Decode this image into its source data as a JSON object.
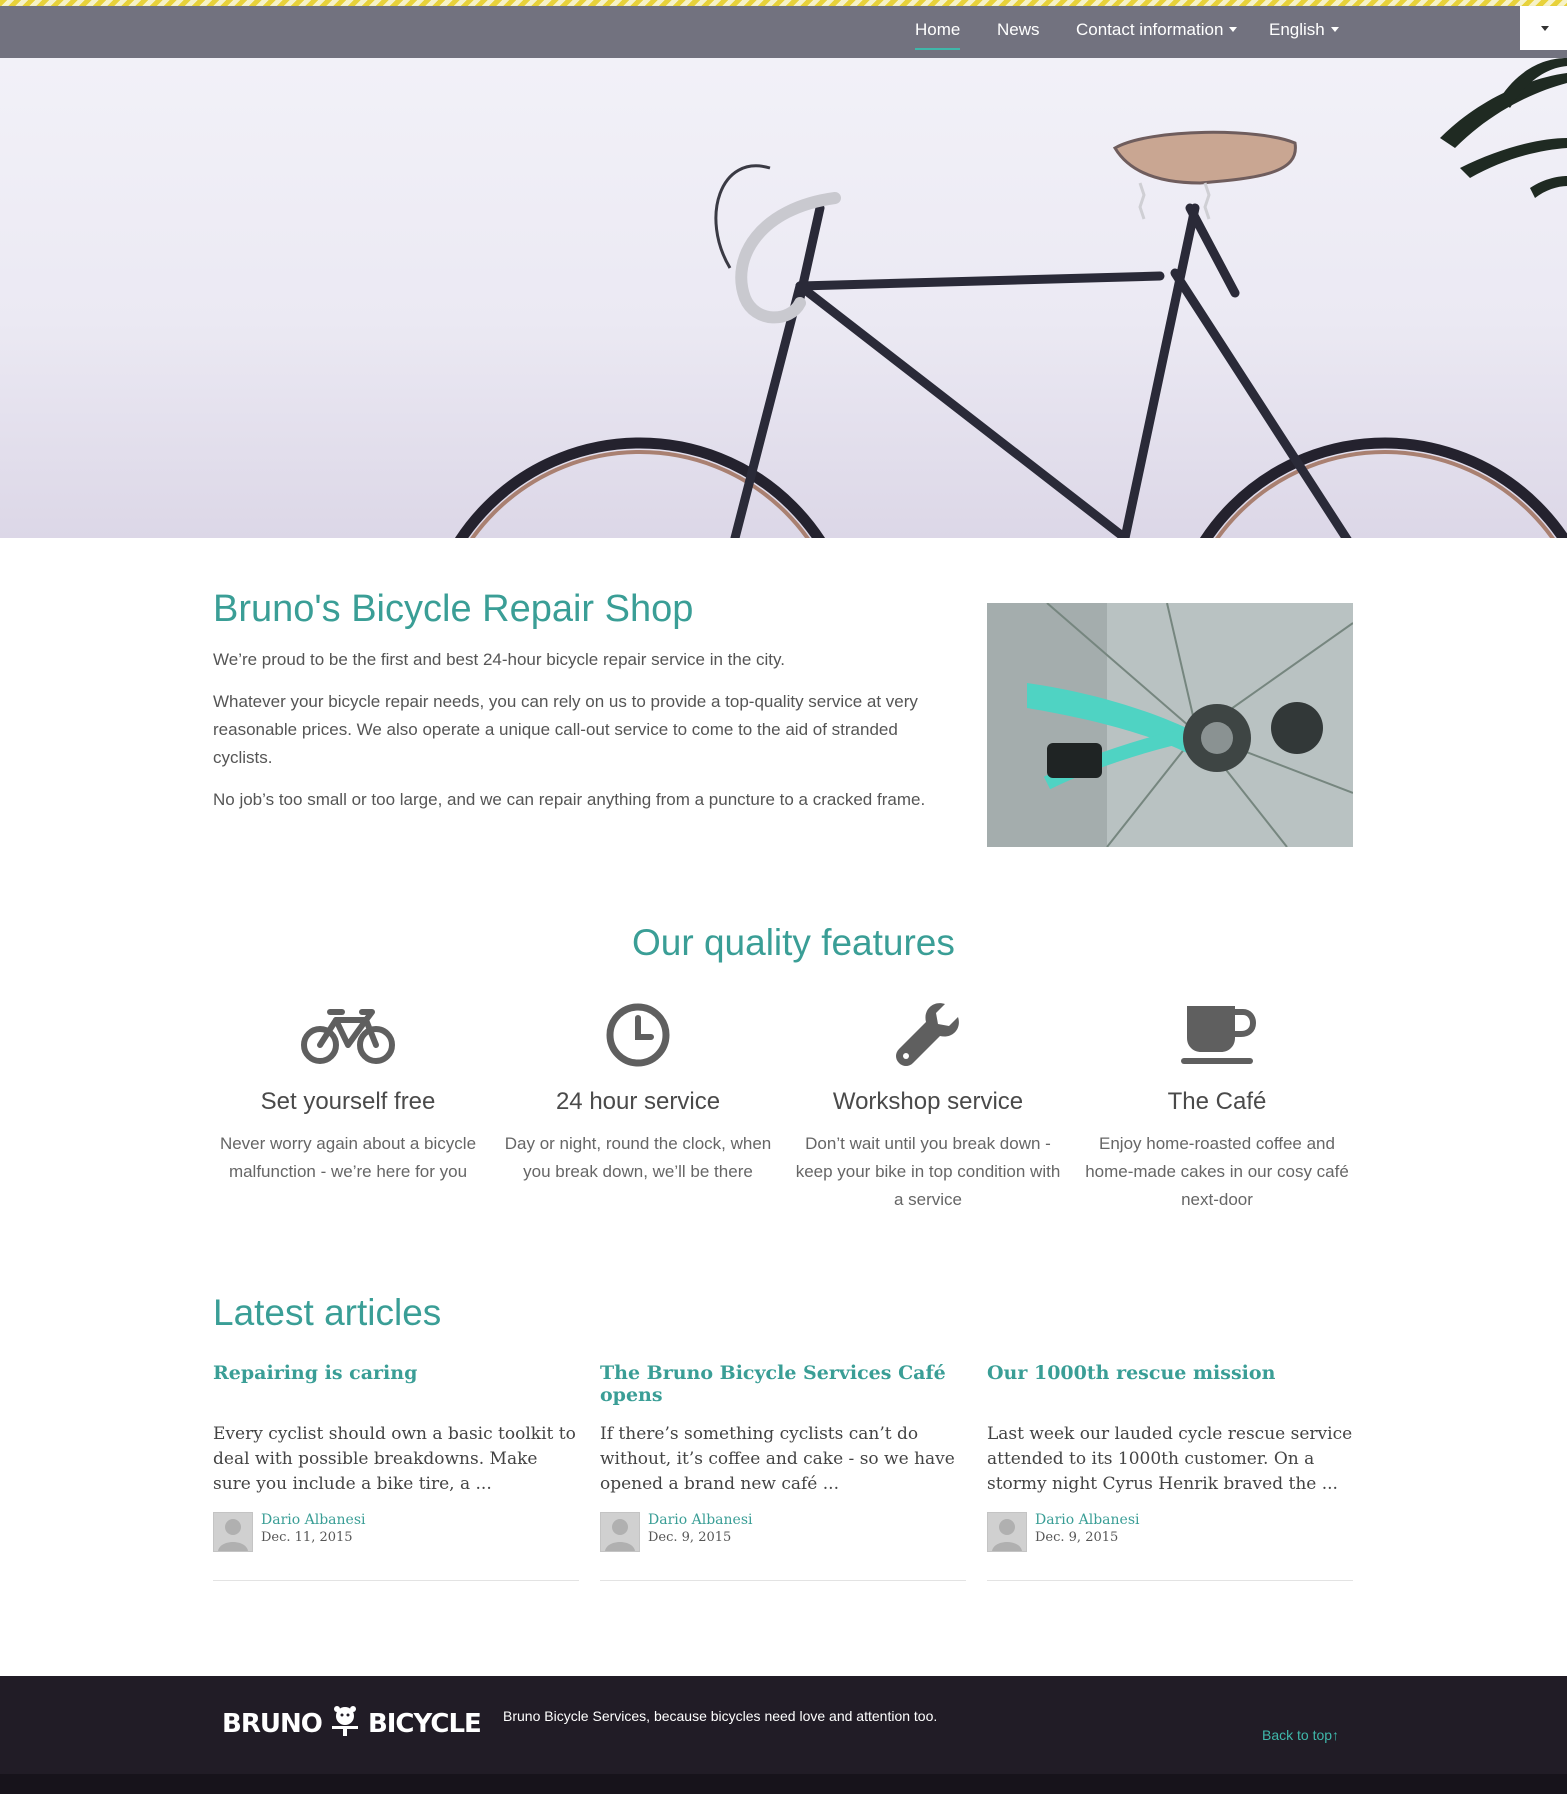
{
  "nav": {
    "items": [
      {
        "label": "Home"
      },
      {
        "label": "News"
      },
      {
        "label": "Contact information"
      },
      {
        "label": "English"
      }
    ]
  },
  "intro": {
    "title": "Bruno's Bicycle Repair Shop",
    "paragraphs": [
      "We’re proud to be the first and best 24-hour bicycle repair service in the city.",
      "Whatever your bicycle repair needs, you can rely on us to provide a top-quality service at very reasonable prices. We also operate a unique call-out service to come to the aid of stranded cyclists.",
      "No job’s too small or too large, and we can repair anything from a puncture to a cracked frame."
    ]
  },
  "features": {
    "title": "Our quality features",
    "items": [
      {
        "icon": "bicycle-icon",
        "title": "Set yourself free",
        "text": "Never worry again about a bicycle malfunction - we’re here for you"
      },
      {
        "icon": "clock-icon",
        "title": "24 hour service",
        "text": "Day or night, round the clock, when you break down, we’ll be there"
      },
      {
        "icon": "wrench-icon",
        "title": "Workshop service",
        "text": "Don’t wait until you break down - keep your bike in top condition with a service"
      },
      {
        "icon": "coffee-cup-icon",
        "title": "The Café",
        "text": "Enjoy home-roasted coffee and home-made cakes in our cosy café next-door"
      }
    ]
  },
  "articles": {
    "title": "Latest articles",
    "items": [
      {
        "title": "Repairing is caring",
        "excerpt": "Every cyclist should own a basic toolkit to deal with possible breakdowns. Make sure you include a bike tire, a ...",
        "author": "Dario Albanesi",
        "date": "Dec. 11, 2015"
      },
      {
        "title": "The Bruno Bicycle Services Café opens",
        "excerpt": "If there’s something cyclists can’t do without, it’s coffee and cake - so we have opened a brand new café ...",
        "author": "Dario Albanesi",
        "date": "Dec. 9, 2015"
      },
      {
        "title": "Our 1000th rescue mission",
        "excerpt": "Last week our lauded cycle rescue service attended to its 1000th customer. On a stormy night Cyrus Henrik braved the ...",
        "author": "Dario Albanesi",
        "date": "Dec. 9, 2015"
      }
    ]
  },
  "footer": {
    "logo_left": "BRUNO",
    "logo_right": "BICYCLE",
    "tagline": "Bruno Bicycle Services, because bicycles need love and attention too.",
    "back_to_top": "Back to top"
  },
  "colors": {
    "accent": "#3a9e96",
    "navbar": "#72727f",
    "footer": "#211c26",
    "stripe": "#e8d23a"
  }
}
